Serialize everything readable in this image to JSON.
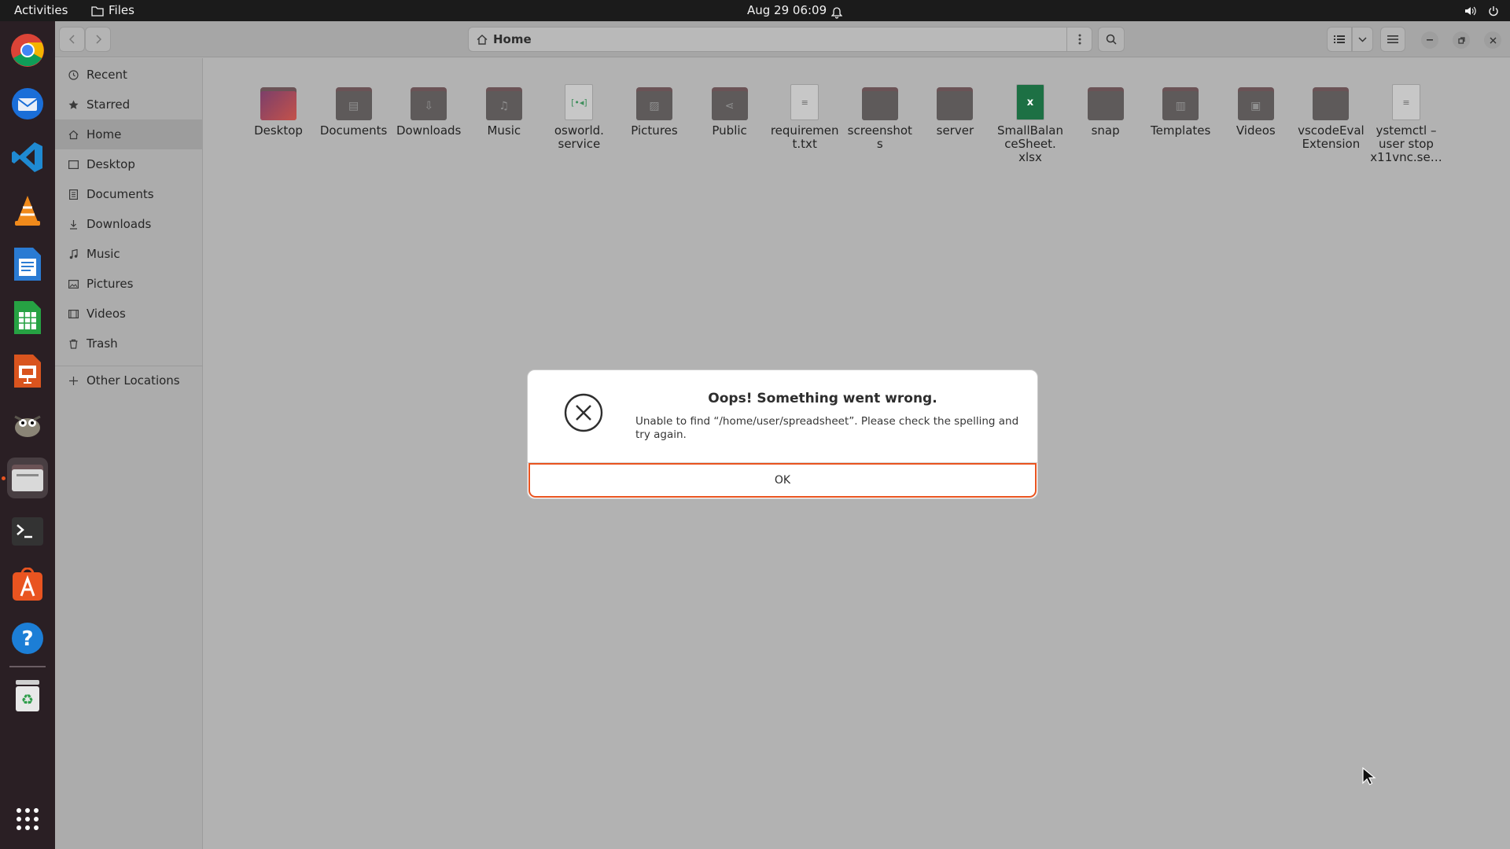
{
  "topbar": {
    "activities": "Activities",
    "app_name": "Files",
    "clock": "Aug 29  06:09"
  },
  "dock": {
    "items": [
      "chrome-icon",
      "thunderbird-icon",
      "vscode-icon",
      "vlc-icon",
      "writer-icon",
      "calc-icon",
      "impress-icon",
      "gimp-icon",
      "files-icon",
      "terminal-icon",
      "software-icon",
      "help-icon",
      "trash-icon",
      "apps-grid-icon"
    ]
  },
  "header": {
    "path": "Home"
  },
  "sidebar": {
    "items": [
      {
        "label": "Recent",
        "icon": "clock-icon"
      },
      {
        "label": "Starred",
        "icon": "star-icon"
      },
      {
        "label": "Home",
        "icon": "home-icon"
      },
      {
        "label": "Desktop",
        "icon": "desktop-icon"
      },
      {
        "label": "Documents",
        "icon": "documents-icon"
      },
      {
        "label": "Downloads",
        "icon": "downloads-icon"
      },
      {
        "label": "Music",
        "icon": "music-icon"
      },
      {
        "label": "Pictures",
        "icon": "pictures-icon"
      },
      {
        "label": "Videos",
        "icon": "videos-icon"
      },
      {
        "label": "Trash",
        "icon": "trash-icon"
      }
    ],
    "other_locations": "Other Locations"
  },
  "files": [
    {
      "name": "Desktop",
      "type": "folder"
    },
    {
      "name": "Documents",
      "type": "folder"
    },
    {
      "name": "Downloads",
      "type": "folder"
    },
    {
      "name": "Music",
      "type": "folder"
    },
    {
      "name": "osworld.\nservice",
      "type": "file"
    },
    {
      "name": "Pictures",
      "type": "folder"
    },
    {
      "name": "Public",
      "type": "folder"
    },
    {
      "name": "requiremen\nt.txt",
      "type": "file"
    },
    {
      "name": "screenshot\ns",
      "type": "folder"
    },
    {
      "name": "server",
      "type": "folder"
    },
    {
      "name": "SmallBalan\nceSheet.\nxlsx",
      "type": "spreadsheet"
    },
    {
      "name": "snap",
      "type": "folder"
    },
    {
      "name": "Templates",
      "type": "folder"
    },
    {
      "name": "Videos",
      "type": "folder"
    },
    {
      "name": "vscodeEval\nExtension",
      "type": "folder"
    },
    {
      "name": "ystemctl –\nuser stop\nx11vnc.se…",
      "type": "file"
    }
  ],
  "dialog": {
    "title": "Oops! Something went wrong.",
    "message": "Unable to find “/home/user/spreadsheet”. Please check the spelling and try again.",
    "ok_label": "OK"
  },
  "colors": {
    "accent": "#e95420",
    "topbar": "#1b1b1b",
    "dock": "#2a1f24",
    "window_bg": "#b2b2b2"
  }
}
